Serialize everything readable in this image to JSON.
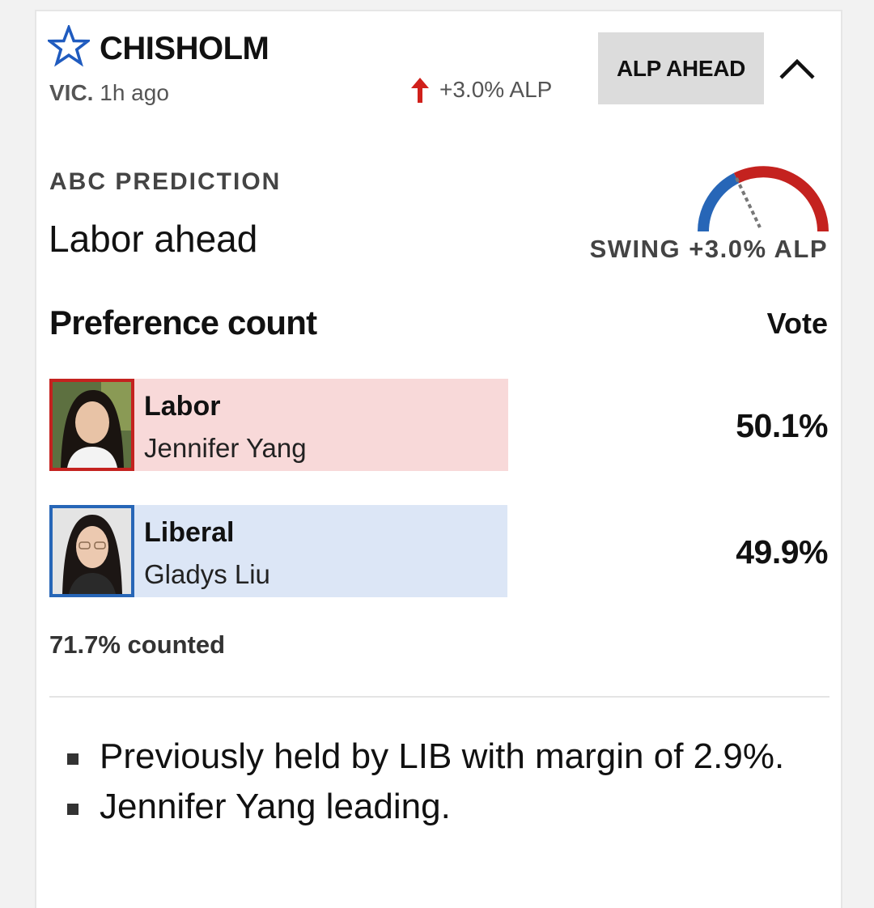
{
  "seat": {
    "name": "CHISHOLM",
    "state": "VIC.",
    "updated": "1h ago",
    "swing_summary": "+3.0% ALP",
    "status_button": "ALP AHEAD"
  },
  "prediction": {
    "label": "ABC PREDICTION",
    "value": "Labor ahead",
    "swing_label": "SWING +3.0% ALP",
    "swing_value": 3.0
  },
  "preference": {
    "title": "Preference count",
    "vote_header": "Vote",
    "candidates": [
      {
        "party": "Labor",
        "name": "Jennifer Yang",
        "vote": "50.1%",
        "color": "#c4221f",
        "bar_color": "#f8d9d9"
      },
      {
        "party": "Liberal",
        "name": "Gladys Liu",
        "vote": "49.9%",
        "color": "#2766b7",
        "bar_color": "#dce6f6"
      }
    ],
    "counted": "71.7% counted"
  },
  "notes": [
    "Previously held by LIB with margin of 2.9%.",
    "Jennifer Yang leading."
  ],
  "colors": {
    "labor": "#c4221f",
    "liberal": "#2766b7",
    "star": "#1f5bbf",
    "arrow": "#d0201b"
  }
}
